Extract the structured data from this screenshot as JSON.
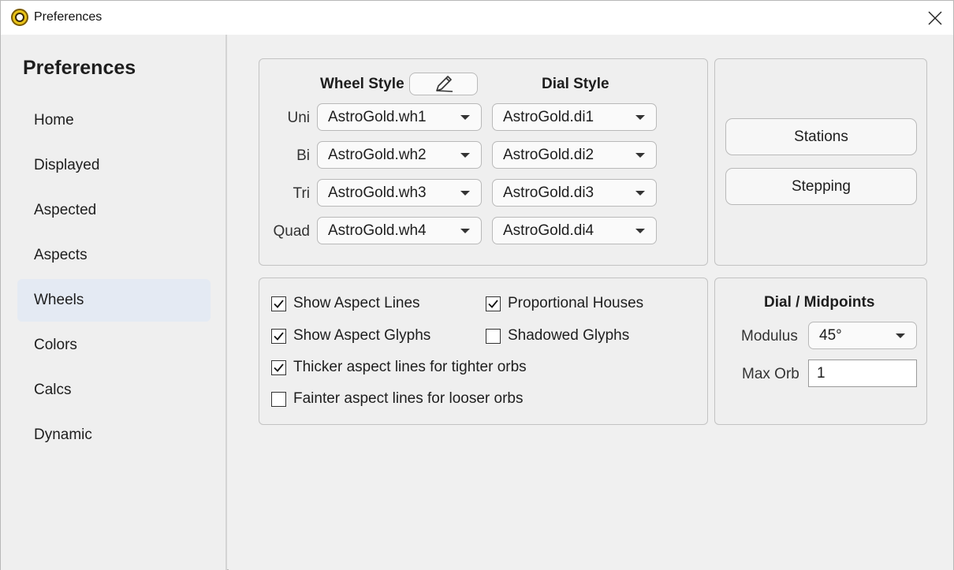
{
  "window": {
    "title": "Preferences",
    "close_icon": "close-icon",
    "app_icon": "astrogold-app-icon"
  },
  "sidebar": {
    "title": "Preferences",
    "items": [
      {
        "label": "Home"
      },
      {
        "label": "Displayed"
      },
      {
        "label": "Aspected"
      },
      {
        "label": "Aspects"
      },
      {
        "label": "Wheels",
        "active": true
      },
      {
        "label": "Colors"
      },
      {
        "label": "Calcs"
      },
      {
        "label": "Dynamic"
      }
    ]
  },
  "styles": {
    "wheel_header": "Wheel Style",
    "dial_header": "Dial Style",
    "edit_icon": "pencil-icon",
    "rows": [
      {
        "label": "Uni",
        "wheel": "AstroGold.wh1",
        "dial": "AstroGold.di1"
      },
      {
        "label": "Bi",
        "wheel": "AstroGold.wh2",
        "dial": "AstroGold.di2"
      },
      {
        "label": "Tri",
        "wheel": "AstroGold.wh3",
        "dial": "AstroGold.di3"
      },
      {
        "label": "Quad",
        "wheel": "AstroGold.wh4",
        "dial": "AstroGold.di4"
      }
    ]
  },
  "actions": {
    "stations": "Stations",
    "stepping": "Stepping"
  },
  "options": {
    "show_aspect_lines": {
      "label": "Show Aspect Lines",
      "checked": true
    },
    "proportional_houses": {
      "label": "Proportional Houses",
      "checked": true
    },
    "show_aspect_glyphs": {
      "label": "Show Aspect Glyphs",
      "checked": true
    },
    "shadowed_glyphs": {
      "label": "Shadowed Glyphs",
      "checked": false
    },
    "thicker_lines": {
      "label": "Thicker aspect lines for tighter orbs",
      "checked": true
    },
    "fainter_lines": {
      "label": "Fainter aspect lines for looser orbs",
      "checked": false
    }
  },
  "dial_midpoints": {
    "title": "Dial / Midpoints",
    "modulus_label": "Modulus",
    "modulus_value": "45°",
    "max_orb_label": "Max Orb",
    "max_orb_value": "1"
  },
  "colors": {
    "active_nav_bg": "#e4eaf3",
    "panel_bg": "#efefef",
    "border": "#c3c3c3"
  }
}
